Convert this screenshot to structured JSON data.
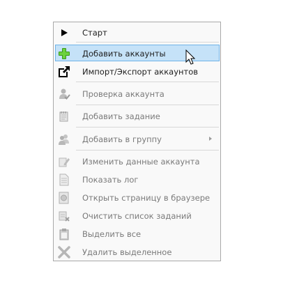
{
  "menu": {
    "items": [
      {
        "label": "Старт",
        "icon": "play-icon",
        "enabled": true
      },
      {
        "label": "Добавить аккаунты",
        "icon": "green-plus-icon",
        "enabled": true,
        "highlighted": true
      },
      {
        "label": "Импорт/Экспорт аккаунтов",
        "icon": "external-link-icon",
        "enabled": true
      },
      {
        "label": "Проверка аккаунта",
        "icon": "user-check-icon",
        "enabled": false
      },
      {
        "label": "Добавить задание",
        "icon": "notepad-add-icon",
        "enabled": false
      },
      {
        "label": "Добавить в группу",
        "icon": "users-group-icon",
        "enabled": false,
        "submenu": true
      },
      {
        "label": "Изменить данные аккаунта",
        "icon": "edit-pencil-icon",
        "enabled": false
      },
      {
        "label": "Показать лог",
        "icon": "document-log-icon",
        "enabled": false
      },
      {
        "label": "Открыть страницу в браузере",
        "icon": "browser-page-icon",
        "enabled": false
      },
      {
        "label": "Очистить список заданий",
        "icon": "clear-tasks-icon",
        "enabled": false
      },
      {
        "label": "Выделить все",
        "icon": "clipboard-select-icon",
        "enabled": false
      },
      {
        "label": "Удалить выделенное",
        "icon": "delete-x-icon",
        "enabled": false
      }
    ]
  },
  "colors": {
    "highlight_bg": "#c5e2f8",
    "highlight_border": "#6fb3e8",
    "accent_green": "#4caf28"
  }
}
